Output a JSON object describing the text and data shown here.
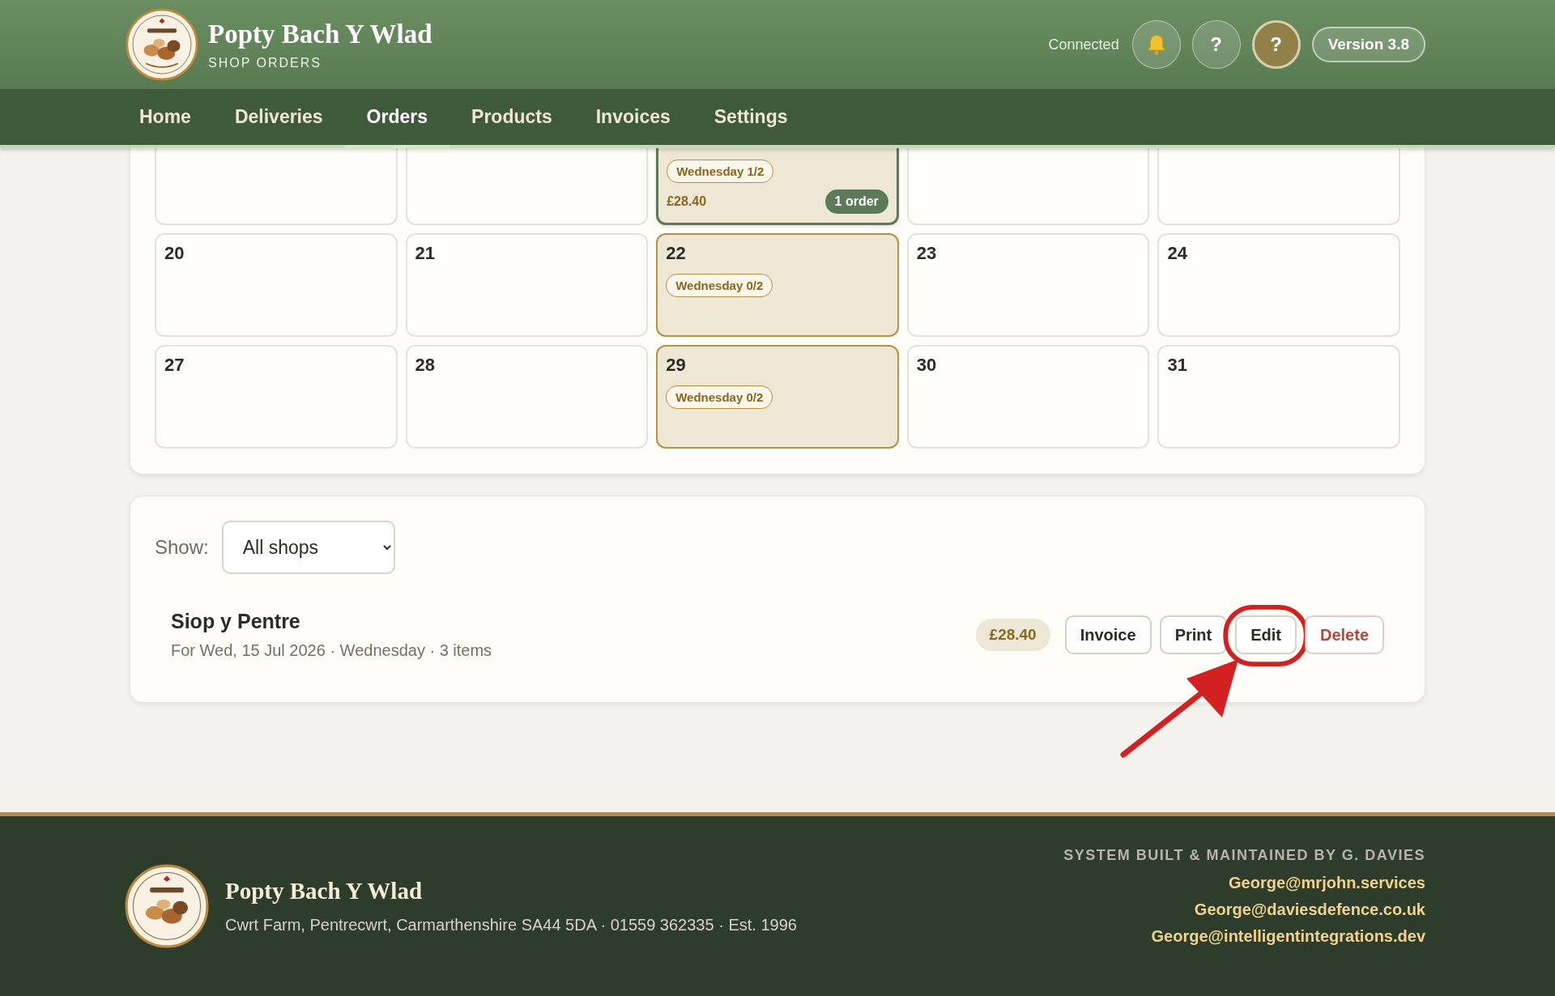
{
  "header": {
    "title": "Popty Bach Y Wlad",
    "subtitle": "SHOP ORDERS",
    "status": "Connected",
    "buttons": [
      {
        "kind": "bell"
      },
      {
        "kind": "help",
        "label": "?"
      },
      {
        "kind": "avatar",
        "label": "?"
      }
    ],
    "version": "Version 3.8"
  },
  "nav": [
    {
      "label": "Home",
      "selected": false
    },
    {
      "label": "Deliveries",
      "selected": false
    },
    {
      "label": "Orders",
      "selected": true
    },
    {
      "label": "Products",
      "selected": false
    },
    {
      "label": "Invoices",
      "selected": false
    },
    {
      "label": "Settings",
      "selected": false
    }
  ],
  "calendar": {
    "weeks": [
      [
        {
          "kind": "plain",
          "selected": false
        },
        {
          "kind": "plain",
          "selected": false
        },
        {
          "kind": "delivery",
          "slot": "Wednesday 1/2",
          "total": "£28.40",
          "orders": "1 order",
          "selected": true
        },
        {
          "kind": "plain",
          "selected": false
        },
        {
          "kind": "plain",
          "selected": false
        }
      ],
      [
        {
          "day": "20",
          "kind": "plain",
          "selected": false
        },
        {
          "day": "21",
          "kind": "plain",
          "selected": false
        },
        {
          "day": "22",
          "kind": "delivery",
          "slot": "Wednesday 0/2",
          "selected": false
        },
        {
          "day": "23",
          "kind": "plain",
          "selected": false
        },
        {
          "day": "24",
          "kind": "plain",
          "selected": false
        }
      ],
      [
        {
          "day": "27",
          "kind": "plain",
          "selected": false
        },
        {
          "day": "28",
          "kind": "plain",
          "selected": false
        },
        {
          "day": "29",
          "kind": "delivery",
          "slot": "Wednesday 0/2",
          "selected": false
        },
        {
          "day": "30",
          "kind": "plain",
          "selected": false
        },
        {
          "day": "31",
          "kind": "plain",
          "selected": false
        }
      ]
    ]
  },
  "filter": {
    "label": "Show:",
    "value": "All shops"
  },
  "orders": [
    {
      "shop": "Siop y Pentre",
      "detail": "For Wed, 15 Jul 2026 · Wednesday · 3 items",
      "total": "£28.40",
      "actions": [
        {
          "label": "Invoice",
          "kind": "default",
          "annotated": false
        },
        {
          "label": "Print",
          "kind": "default",
          "annotated": false
        },
        {
          "label": "Edit",
          "kind": "default",
          "annotated": true
        },
        {
          "label": "Delete",
          "kind": "danger",
          "annotated": false
        }
      ]
    }
  ],
  "footer": {
    "name": "Popty Bach Y Wlad",
    "address": "Cwrt Farm, Pentrecwrt, Carmarthenshire SA44 5DA · 01559 362335 · Est. 1996",
    "credit": "SYSTEM BUILT & MAINTAINED BY G. DAVIES",
    "emails": [
      "George@mrjohn.services",
      "George@daviesdefence.co.uk",
      "George@intelligentintegrations.dev"
    ]
  }
}
